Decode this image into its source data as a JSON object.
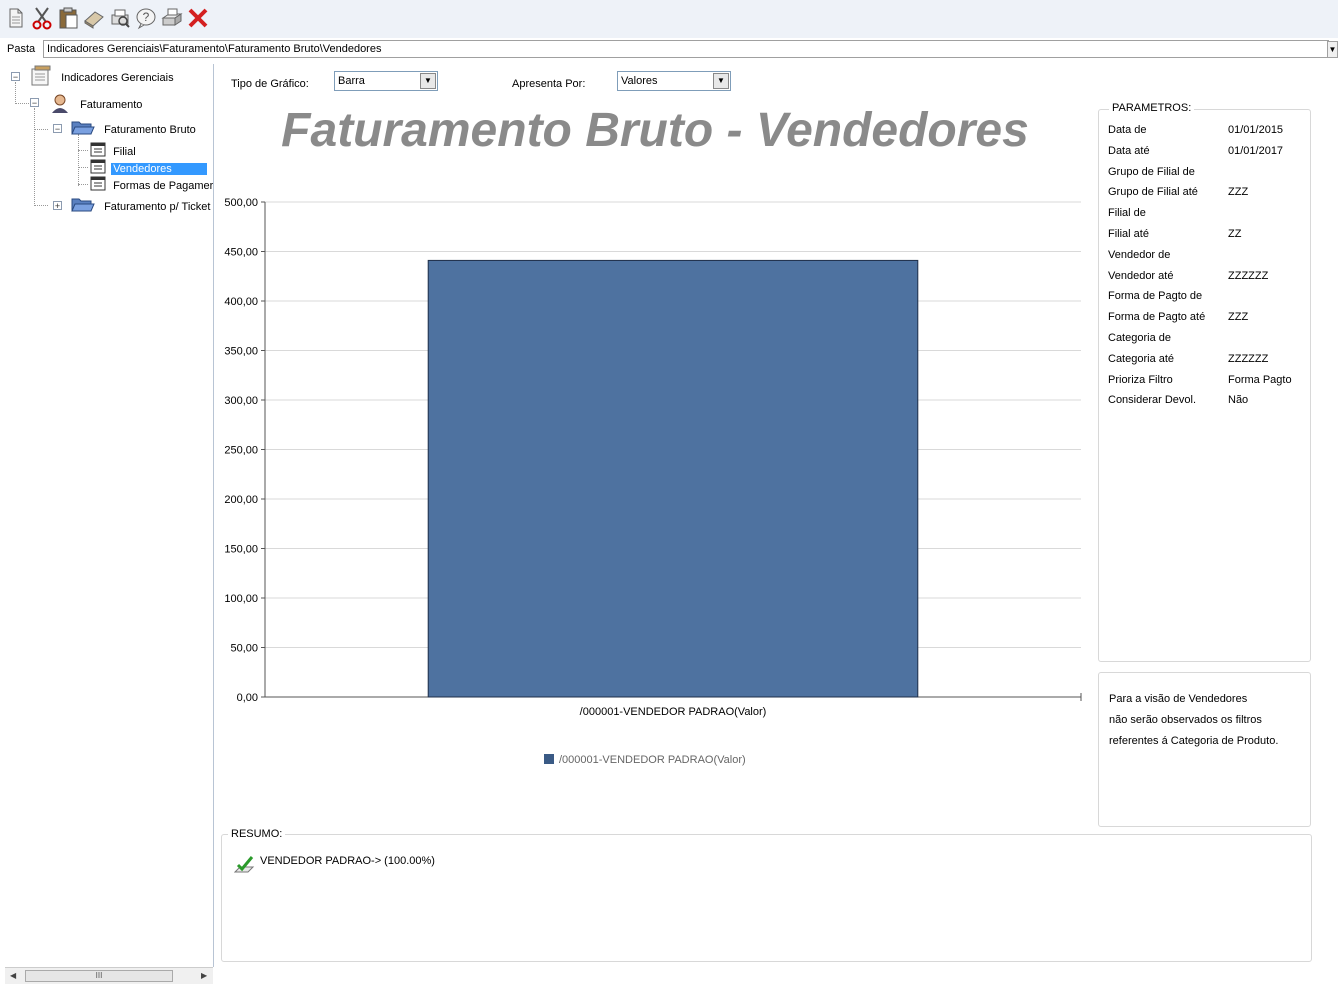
{
  "toolbar": {
    "icons": [
      "new-document-icon",
      "cut-icon",
      "paste-icon",
      "eraser-icon",
      "print-preview-icon",
      "help-icon",
      "print-icon",
      "close-icon"
    ]
  },
  "path": {
    "label": "Pasta",
    "value": "Indicadores Gerenciais\\Faturamento\\Faturamento Bruto\\Vendedores"
  },
  "tree": {
    "root": "Indicadores Gerenciais",
    "faturamento": "Faturamento",
    "bruto": "Faturamento Bruto",
    "filial": "Filial",
    "vendedores": "Vendedores",
    "formas": "Formas de Pagamer",
    "ticket": "Faturamento p/ Ticket",
    "scroll_thumb": "III"
  },
  "controls": {
    "tipo_label": "Tipo de Gráfico:",
    "tipo_value": "Barra",
    "apresenta_label": "Apresenta Por:",
    "apresenta_value": "Valores"
  },
  "chart_data": {
    "type": "bar",
    "title": "Faturamento Bruto - Vendedores",
    "categories": [
      "/000001-VENDEDOR PADRAO(Valor)"
    ],
    "series": [
      {
        "name": "/000001-VENDEDOR PADRAO(Valor)",
        "values": [
          441
        ]
      }
    ],
    "ylim": [
      0,
      500
    ],
    "yticks": [
      "0,00",
      "50,00",
      "100,00",
      "150,00",
      "200,00",
      "250,00",
      "300,00",
      "350,00",
      "400,00",
      "450,00",
      "500,00"
    ],
    "grid": true,
    "legend": "bottom",
    "bar_color": "#4e72a0"
  },
  "parametros": {
    "title": "PARAMETROS:",
    "rows": [
      {
        "label": "Data de",
        "value": "01/01/2015"
      },
      {
        "label": "Data até",
        "value": "01/01/2017"
      },
      {
        "label": "Grupo de Filial de",
        "value": ""
      },
      {
        "label": "Grupo de Filial até",
        "value": "ZZZ"
      },
      {
        "label": "Filial de",
        "value": ""
      },
      {
        "label": "Filial até",
        "value": "ZZ"
      },
      {
        "label": "Vendedor de",
        "value": ""
      },
      {
        "label": "Vendedor até",
        "value": "ZZZZZZ"
      },
      {
        "label": "Forma de Pagto de",
        "value": ""
      },
      {
        "label": "Forma de Pagto até",
        "value": "ZZZ"
      },
      {
        "label": "Categoria de",
        "value": ""
      },
      {
        "label": "Categoria até",
        "value": "ZZZZZZ"
      },
      {
        "label": "Prioriza Filtro",
        "value": "Forma Pagto"
      },
      {
        "label": "Considerar Devol.",
        "value": "Não"
      }
    ]
  },
  "note": {
    "line1": "Para a visão de Vendedores",
    "line2": "não serão observados os filtros",
    "line3": "referentes á Categoria de Produto."
  },
  "resumo": {
    "title": "RESUMO:",
    "item": "VENDEDOR PADRAO-> (100.00%)"
  }
}
